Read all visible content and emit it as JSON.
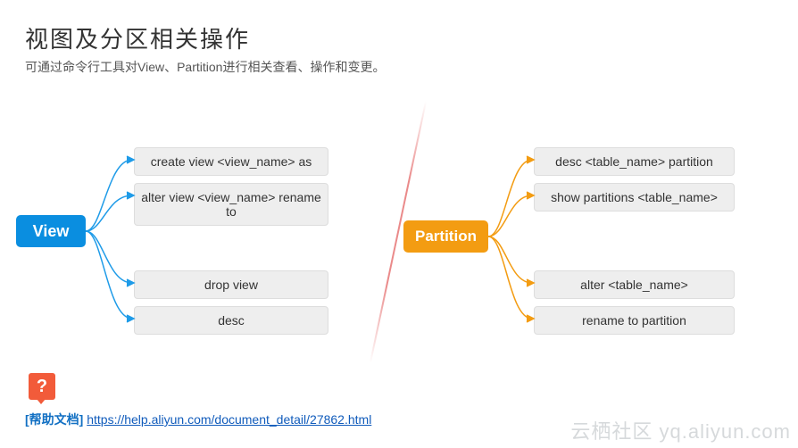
{
  "title": "视图及分区相关操作",
  "subtitle": "可通过命令行工具对View、Partition进行相关查看、操作和变更。",
  "view": {
    "label": "View",
    "ops": [
      "create view <view_name> as",
      "alter view <view_name> rename to",
      "drop view",
      "desc"
    ]
  },
  "partition": {
    "label": "Partition",
    "ops": [
      "desc <table_name> partition",
      "show partitions <table_name>",
      "alter <table_name>",
      "rename to partition"
    ]
  },
  "help": {
    "icon": "?",
    "label": "[帮助文档]",
    "url": "https://help.aliyun.com/document_detail/27862.html"
  },
  "watermark": "云栖社区 yq.aliyun.com",
  "colors": {
    "view": "#0a8ee0",
    "partition": "#f39c12",
    "help_icon": "#f25b3a"
  }
}
